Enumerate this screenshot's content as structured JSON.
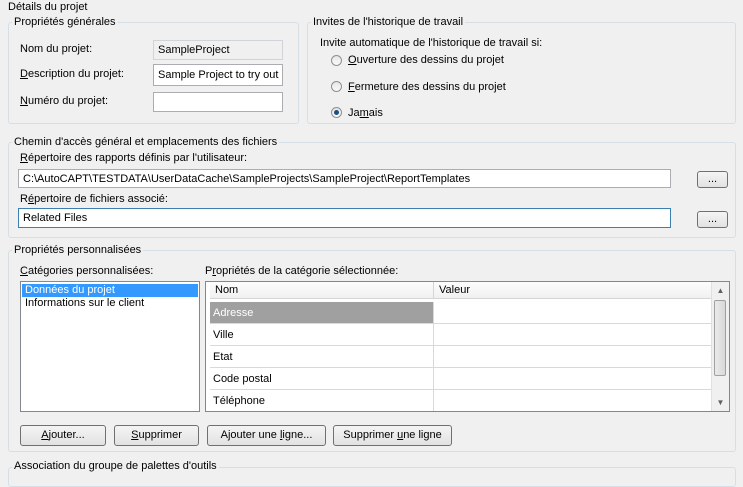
{
  "top_title": "Détails du projet",
  "general": {
    "title": "Propriétés générales",
    "name_label": "Nom du projet:",
    "name_value": "SampleProject",
    "desc_label": "Description du projet:",
    "desc_value": "Sample Project to try out P",
    "num_label": "Numéro du projet:",
    "num_value": ""
  },
  "history": {
    "title": "Invites de l'historique de travail",
    "prompt": "Invite automatique de l'historique de travail si:",
    "options": [
      {
        "label": "Ouverture des dessins du projet",
        "checked": false
      },
      {
        "label": "Fermeture des dessins du projet",
        "checked": false
      },
      {
        "label": "Jamais",
        "checked": true
      }
    ]
  },
  "paths": {
    "title": "Chemin d'accès général et emplacements des fichiers",
    "reports_label": "Répertoire des rapports définis par l'utilisateur:",
    "reports_value": "C:\\AutoCAPT\\TESTDATA\\UserDataCache\\SampleProjects\\SampleProject\\ReportTemplates",
    "assoc_label": "Répertoire de fichiers associé:",
    "assoc_value": "Related Files",
    "browse_label": "..."
  },
  "custom": {
    "title": "Propriétés personnalisées",
    "categories_label": "Catégories personnalisées:",
    "categories": [
      "Données du projet",
      "Informations sur le client"
    ],
    "selected_category": 0,
    "props_label": "Propriétés de la catégorie sélectionnée:",
    "columns": [
      "Nom",
      "Valeur"
    ],
    "rows": [
      {
        "name": "Adresse",
        "value": ""
      },
      {
        "name": "Ville",
        "value": ""
      },
      {
        "name": "Etat",
        "value": ""
      },
      {
        "name": "Code postal",
        "value": ""
      },
      {
        "name": "Téléphone",
        "value": ""
      }
    ],
    "buttons": {
      "add": "Ajouter...",
      "delete": "Supprimer",
      "add_row": "Ajouter une ligne...",
      "delete_row": "Supprimer une ligne"
    }
  },
  "palette": {
    "title": "Association du groupe de palettes d'outils"
  }
}
